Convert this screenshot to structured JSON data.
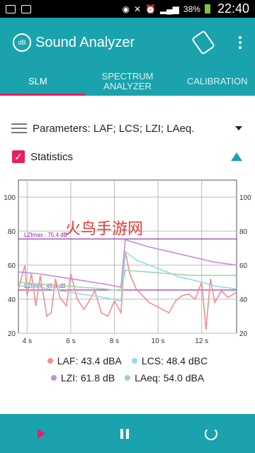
{
  "status": {
    "battery": "38%",
    "time": "22:40"
  },
  "app": {
    "title": "Sound Analyzer"
  },
  "tabs": [
    {
      "label": "SLM"
    },
    {
      "label": "SPECTRUM ANALYZER"
    },
    {
      "label": "CALIBRATION"
    }
  ],
  "parameters_label": "Parameters: LAF; LCS; LZI; LAeq.",
  "statistics_label": "Statistics",
  "chart_data": {
    "type": "line",
    "xlabel": "",
    "ylabel": "",
    "xlim": [
      3.6,
      13.6
    ],
    "ylim": [
      20,
      110
    ],
    "xticks": [
      "4 s",
      "6 s",
      "8 s",
      "10 s",
      "12 s"
    ],
    "xtick_values": [
      4,
      6,
      8,
      10,
      12
    ],
    "yticks": [
      20,
      40,
      60,
      80,
      100
    ],
    "reference_lines": [
      {
        "label": "LZImax : 75.4 dB",
        "value": 75.4
      },
      {
        "label": "LZImin : 45.4 dB",
        "value": 45.4
      }
    ],
    "series": [
      {
        "name": "LAF",
        "color": "#f28f8f",
        "x": [
          3.6,
          3.9,
          4.0,
          4.2,
          4.4,
          4.6,
          4.9,
          5.1,
          5.3,
          5.5,
          5.8,
          6.0,
          6.3,
          6.6,
          6.8,
          7.1,
          7.4,
          7.7,
          8.0,
          8.3,
          8.5,
          8.7,
          9.0,
          9.3,
          9.6,
          9.9,
          10.2,
          10.5,
          10.8,
          11.1,
          11.4,
          11.7,
          12.0,
          12.2,
          12.4,
          12.6,
          12.9,
          13.2,
          13.6
        ],
        "y": [
          46,
          60,
          42,
          55,
          36,
          54,
          30,
          32,
          52,
          41,
          36,
          55,
          40,
          34,
          38,
          45,
          32,
          30,
          39,
          32,
          68,
          55,
          46,
          42,
          38,
          36,
          34,
          32,
          39,
          42,
          43,
          40,
          50,
          22,
          52,
          38,
          45,
          41,
          44
        ]
      },
      {
        "name": "LCS",
        "color": "#8fdde8",
        "x": [
          3.6,
          4.5,
          5.5,
          6.5,
          7.5,
          8.3,
          8.5,
          9.0,
          10.0,
          11.0,
          12.0,
          12.5,
          13.0,
          13.6
        ],
        "y": [
          48,
          47,
          45,
          43,
          41,
          39,
          68,
          63,
          58,
          53,
          50,
          48,
          47,
          46
        ]
      },
      {
        "name": "LZI",
        "color": "#c38ed8",
        "x": [
          3.6,
          4.5,
          5.5,
          6.5,
          7.5,
          8.3,
          8.5,
          9.5,
          10.5,
          11.5,
          12.5,
          13.0,
          13.6
        ],
        "y": [
          56,
          55,
          53,
          51,
          49,
          47,
          75,
          71,
          68,
          65,
          62,
          61,
          60
        ]
      },
      {
        "name": "LAeq",
        "color": "#9fd6a8",
        "x": [
          3.6,
          4.5,
          5.5,
          6.5,
          7.5,
          8.3,
          8.5,
          9.5,
          10.5,
          11.5,
          12.5,
          13.6
        ],
        "y": [
          50,
          49,
          48,
          47,
          46,
          45,
          57,
          56,
          55,
          54,
          54,
          54
        ]
      }
    ]
  },
  "legend": [
    {
      "text": "LAF: 43.4 dBA",
      "color": "#f28f8f"
    },
    {
      "text": "LCS: 48.4 dBC",
      "color": "#8fdde8"
    },
    {
      "text": "LZI: 61.8 dB",
      "color": "#c38ed8"
    },
    {
      "text": "LAeq: 54.0 dBA",
      "color": "#9fd6a8"
    }
  ],
  "watermark": "火鸟手游网"
}
